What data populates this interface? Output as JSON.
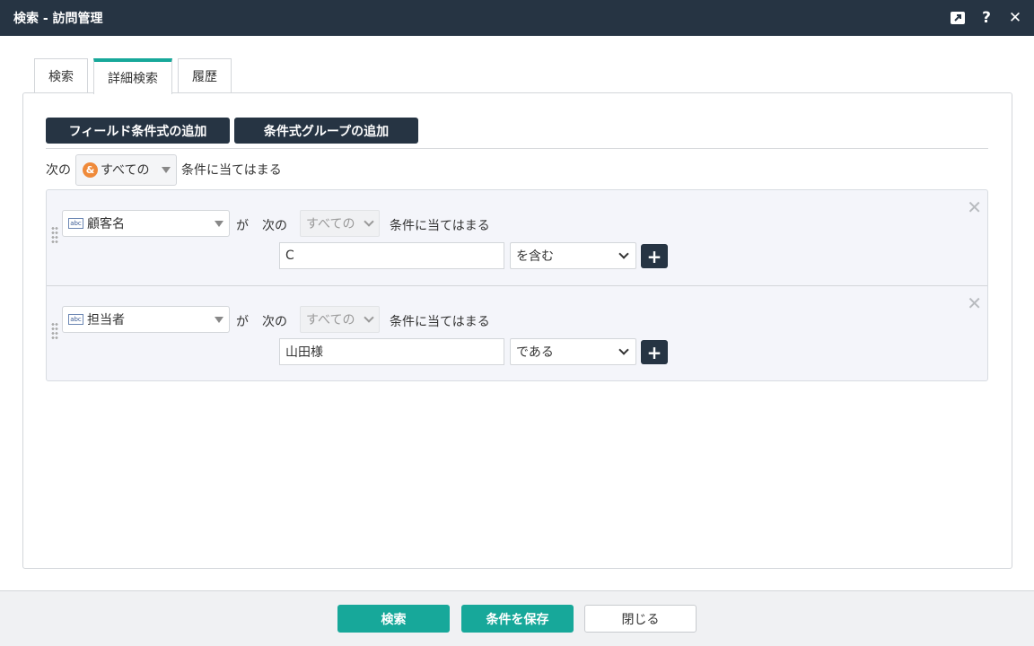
{
  "window": {
    "title": "検索 - 訪問管理"
  },
  "tabs": [
    {
      "label": "検索",
      "active": false
    },
    {
      "label": "詳細検索",
      "active": true
    },
    {
      "label": "履歴",
      "active": false
    }
  ],
  "toolbar": {
    "add_field_condition": "フィールド条件式の追加",
    "add_condition_group": "条件式グループの追加"
  },
  "match": {
    "prefix": "次の",
    "selected": "すべての",
    "suffix": "条件に当てはまる"
  },
  "conditions": [
    {
      "field": "顧客名",
      "ga": "が",
      "next": "次の",
      "sub_selected": "すべての",
      "suffix": "条件に当てはまる",
      "value": "C",
      "operator": "を含む"
    },
    {
      "field": "担当者",
      "ga": "が",
      "next": "次の",
      "sub_selected": "すべての",
      "suffix": "条件に当てはまる",
      "value": "山田様",
      "operator": "である"
    }
  ],
  "footer": {
    "search": "検索",
    "save_conditions": "条件を保存",
    "close": "閉じる"
  },
  "colors": {
    "titlebar": "#263443",
    "accent": "#17a89a",
    "amp_badge": "#ef8a3a"
  },
  "icons": [
    "expand-icon",
    "help-icon",
    "close-icon",
    "ampersand-icon",
    "text-field-icon",
    "drag-handle-icon",
    "remove-icon",
    "plus-icon"
  ]
}
